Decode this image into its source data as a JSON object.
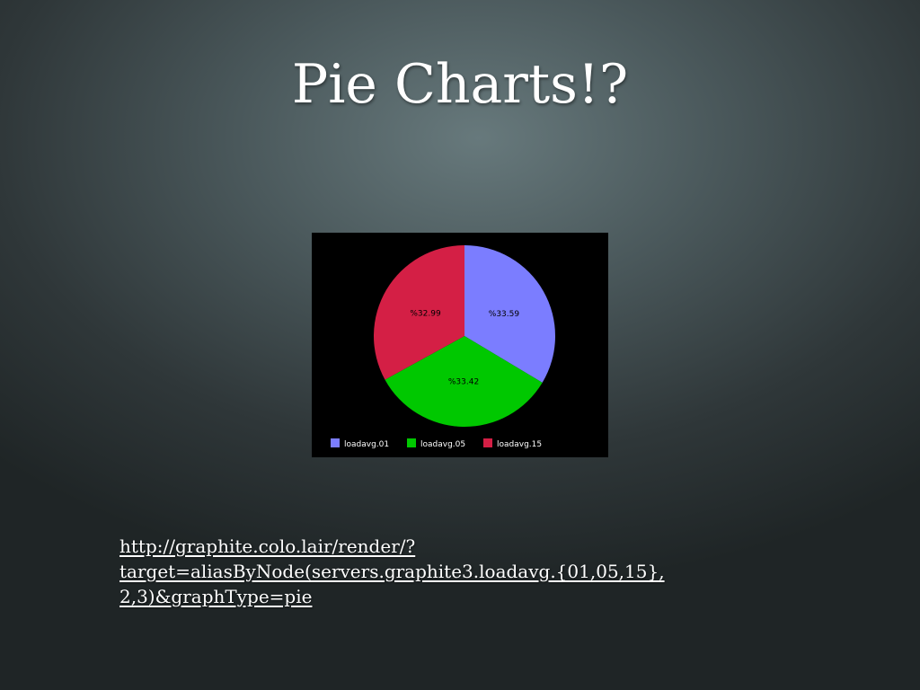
{
  "slide": {
    "title": "Pie Charts!?",
    "link_lines": [
      "http://graphite.colo.lair/render/?",
      "target=aliasByNode(servers.graphite3.loadavg.{01,05,15},",
      "2,3)&graphType=pie"
    ]
  },
  "chart_data": {
    "type": "pie",
    "background": "#000000",
    "legend_position": "bottom",
    "slices": [
      {
        "name": "loadavg.01",
        "value": 33.59,
        "label": "%33.59",
        "color": "#7b7dff"
      },
      {
        "name": "loadavg.05",
        "value": 33.42,
        "label": "%33.42",
        "color": "#00c800"
      },
      {
        "name": "loadavg.15",
        "value": 32.99,
        "label": "%32.99",
        "color": "#d41f45"
      }
    ]
  }
}
